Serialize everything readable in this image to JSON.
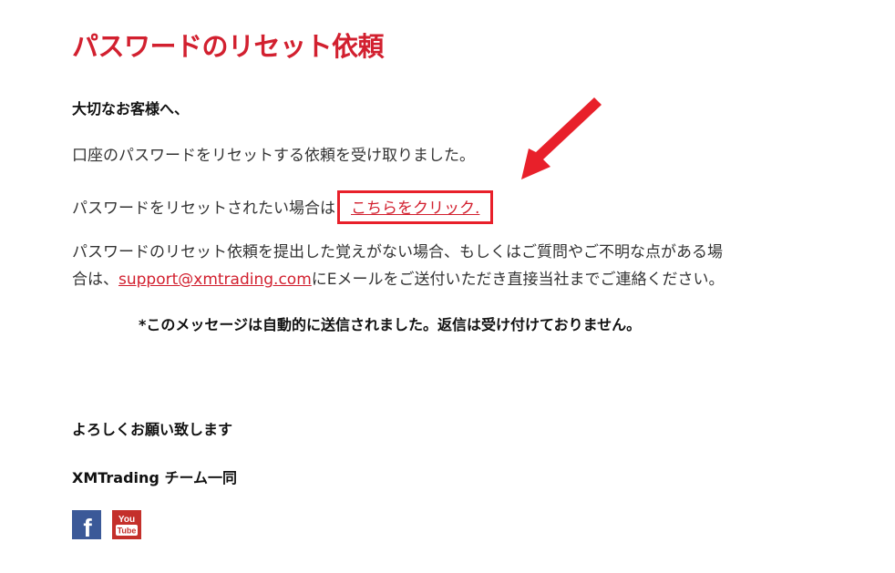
{
  "email": {
    "title": "パスワードのリセット依頼",
    "greeting": "大切なお客様へ、",
    "received_text": "口座のパスワードをリセットする依頼を受け取りました。",
    "reset_prefix": "パスワードをリセットされたい場合は",
    "reset_link_text": "こちらをクリック",
    "reset_suffix": ".",
    "contact_line1": "パスワードのリセット依頼を提出した覚えがない場合、もしくはご質問やご不明な点がある場",
    "contact_line2_prefix": "合は、",
    "support_email": "support@xmtrading.com",
    "contact_line2_suffix": "にEメールをご送付いただき直接当社までご連絡ください。",
    "auto_notice": "*このメッセージは自動的に送信されました。返信は受け付けておりません。",
    "closing": "よろしくお願い致します",
    "team": "XMTrading チーム一同"
  },
  "social": {
    "facebook_letter": "f",
    "youtube_top": "You",
    "youtube_bottom": "Tube",
    "facebook_color": "#3b5998",
    "youtube_color": "#c4302b"
  },
  "colors": {
    "accent": "#d2202f",
    "highlight": "#e8202a"
  }
}
